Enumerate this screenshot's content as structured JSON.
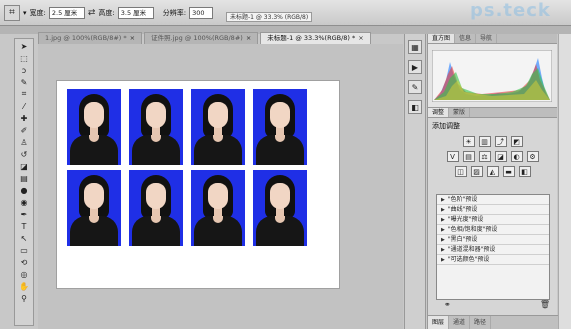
{
  "options_bar": {
    "width_label": "宽度:",
    "width_value": "2.5 厘米",
    "height_label": "高度:",
    "height_value": "3.5 厘米",
    "resolution_label": "分辨率:",
    "resolution_value": "300",
    "tooltip": "未标题-1 @ 33.3% (RGB/8)"
  },
  "watermark": "ps.teck",
  "document_tabs": [
    {
      "label": "1.jpg @ 100%(RGB/8#) *",
      "active": false
    },
    {
      "label": "证件照.jpg @ 100%(RGB/8#)",
      "active": false
    },
    {
      "label": "未标题-1 @ 33.3%(RGB/8) *",
      "active": true
    }
  ],
  "tab_close": "×",
  "photos_grid": {
    "rows": 2,
    "cols": 4
  },
  "panel_top_tabs": [
    "直方图",
    "信息",
    "导航"
  ],
  "adjust_panel_tabs": [
    "调整",
    "蒙版"
  ],
  "adjust_title": "添加调整",
  "presets": [
    "\"色阶\"预设",
    "\"曲线\"预设",
    "\"曝光度\"预设",
    "\"色相/饱和度\"预设",
    "\"黑白\"预设",
    "\"通道混和器\"预设",
    "\"可选颜色\"预设"
  ],
  "bottom_tabs": [
    "图层",
    "通道",
    "路径"
  ],
  "colors": {
    "photo_bg": "#1f2fe6",
    "sheet": "#ffffff"
  }
}
